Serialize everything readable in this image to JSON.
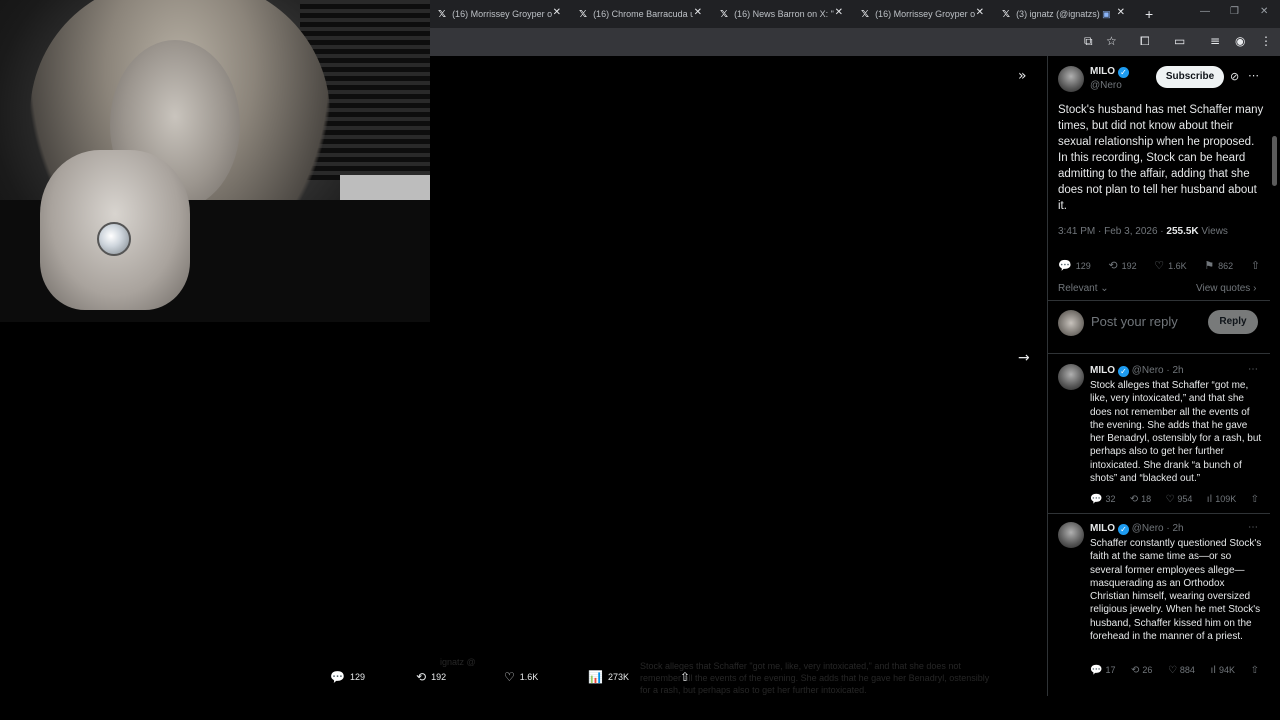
{
  "tabs": [
    {
      "title": "(16) Morrissey Groyper on",
      "close": "✕"
    },
    {
      "title": "(16) Chrome Barracuda u",
      "close": "✕"
    },
    {
      "title": "(16) News Barron on X: \"E",
      "close": "✕"
    },
    {
      "title": "(16) Morrissey Groyper on",
      "close": "✕"
    },
    {
      "title": "(3) ignatz (@ignatzs) /",
      "close": "✕"
    }
  ],
  "new_tab": "+",
  "tweet": {
    "author": "MILO",
    "handle": "@Nero",
    "subscribe": "Subscribe",
    "text": "Stock's husband has met Schaffer many times, but did not know about their sexual relationship when he proposed. In this recording, Stock can be heard admitting to the affair, adding that she does not plan to tell her husband about it.",
    "time": "3:41 PM · Feb 3, 2026 · ",
    "views_count": "255.5K",
    "views_label": " Views",
    "replies": "129",
    "reposts": "192",
    "likes": "1.6K",
    "bookmarks": "862",
    "sort": "Relevant",
    "view_quotes": "View quotes"
  },
  "reply_box": {
    "placeholder": "Post your reply",
    "button": "Reply"
  },
  "replies": [
    {
      "author": "MILO",
      "meta": "@Nero · 2h",
      "text": "Stock alleges that Schaffer “got me, like, very intoxicated,” and that she does not remember all the events of the evening. She adds that he gave her Benadryl, ostensibly for a rash, but perhaps also to get her further intoxicated. She drank “a bunch of shots” and “blacked out.”",
      "replies": "32",
      "reposts": "18",
      "likes": "954",
      "views": "109K"
    },
    {
      "author": "MILO",
      "meta": "@Nero · 2h",
      "text": "Schaffer constantly questioned Stock's faith at the same time as—or so several former employees allege—masquerading as an Orthodox Christian himself, wearing oversized religious jewelry. When he met Stock's husband, Schaffer kissed him on the forehead in the manner of a priest.",
      "replies": "17",
      "reposts": "26",
      "likes": "884",
      "views": "94K"
    }
  ],
  "video_actions": {
    "replies": "129",
    "reposts": "192",
    "likes": "1.6K",
    "views": "273K"
  },
  "ghost": {
    "author": "ignatz @",
    "text": "Stock alleges that Schaffer \"got me, like, very intoxicated,\" and that she does not remember all the events of the evening. She adds that he gave her Benadryl, ostensibly for a rash, but perhaps also to get her further intoxicated."
  },
  "icons": {
    "reply": "💬",
    "repost": "⟲",
    "like": "♡",
    "bookmark": "🔖",
    "share": "⇧",
    "views": "📊",
    "more": "⋯"
  }
}
